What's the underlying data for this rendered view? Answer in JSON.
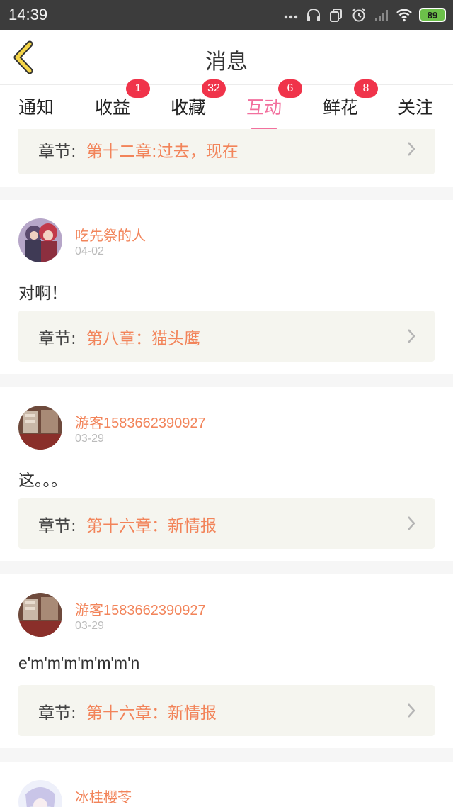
{
  "status_bar": {
    "time": "14:39",
    "battery": "89",
    "icons": [
      "more-dots-icon",
      "headphones-icon",
      "copy-icon",
      "alarm-icon",
      "signal-icon",
      "wifi-icon",
      "battery-icon"
    ]
  },
  "header": {
    "title": "消息",
    "back_icon": "chevron-left-icon"
  },
  "tabs": [
    {
      "label": "通知",
      "badge": ""
    },
    {
      "label": "收益",
      "badge": "1"
    },
    {
      "label": "收藏",
      "badge": "32"
    },
    {
      "label": "互动",
      "badge": "6",
      "active": true
    },
    {
      "label": "鲜花",
      "badge": "8"
    },
    {
      "label": "关注",
      "badge": ""
    }
  ],
  "chapter_label": "章节:",
  "items": [
    {
      "chapter": "第十二章:过去，现在"
    },
    {
      "user": "吃先祭的人",
      "date": "04-02",
      "comment": "对啊！",
      "chapter": "第八章：猫头鹰"
    },
    {
      "user": "游客1583662390927",
      "date": "03-29",
      "comment": "这。。。",
      "chapter": "第十六章：新情报"
    },
    {
      "user": "游客1583662390927",
      "date": "03-29",
      "comment": "e'm'm'm'm'm'm'n",
      "chapter": "第十六章：新情报"
    },
    {
      "user": "冰桂樱苓"
    }
  ],
  "colors": {
    "accent_pink": "#f2709e",
    "username_orange": "#f2845a",
    "badge_red": "#f0334a",
    "back_arrow_yellow": "#f5d547"
  }
}
